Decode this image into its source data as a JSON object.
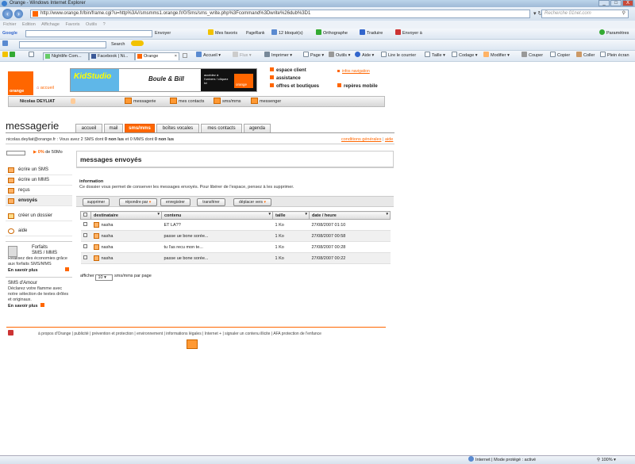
{
  "window": {
    "title": "Orange - Windows Internet Explorer",
    "min": "_",
    "max": "□",
    "close": "X"
  },
  "browser": {
    "url": "http://www.orange.fr/bin/frame.cgi?u=http%3A//smsmms1.orange.fr/0/Sms/sms_write.php%3Fcommand%3Dwrite%26dub%3D1",
    "search_placeholder": "Recherche 01net.com",
    "menu": [
      "Fichier",
      "Edition",
      "Affichage",
      "Favoris",
      "Outils",
      "?"
    ],
    "google_toolbar": {
      "logo": "Google",
      "go": "Envoyer",
      "favorites": "Mes favoris",
      "pagerank": "PageRank",
      "blocked": "12 bloqué(s)",
      "spell": "Orthographe",
      "translate": "Traduire",
      "send": "Envoyer à",
      "settings": "Paramètres"
    },
    "second_toolbar": {
      "search": "Search"
    },
    "tabs": [
      {
        "label": "Nightlife Com..."
      },
      {
        "label": "Facebook | Ni..."
      },
      {
        "label": "Orange"
      }
    ],
    "command_bar": [
      "Accueil",
      "Flux",
      "Imprimer",
      "Page",
      "Outils",
      "Aide",
      "Lire le courrier",
      "Taille",
      "Codage",
      "Modifier",
      "Couper",
      "Copier",
      "Coller",
      "Plein écran"
    ]
  },
  "brand": {
    "logo": "orange",
    "home_link": "accueil"
  },
  "banner": {
    "title": "KidStudio",
    "subtitle": "Boule & Bill",
    "cta": "accédez à l'univers ! cliquez ici",
    "brand": "orange"
  },
  "topnav": {
    "client_space": "espace client",
    "assistance": "assistance",
    "offers": "offres et boutiques",
    "info": "infos navigation",
    "mobile": "repères mobile"
  },
  "userbar": {
    "user": "Nicolas DEYLIAT",
    "items": [
      "messagerie",
      "mes contacts",
      "sms/mms",
      "messenger"
    ]
  },
  "page": {
    "title": "messagerie",
    "tabs": [
      "accueil",
      "mail",
      "sms/mms",
      "boîtes vocales",
      "mes contacts",
      "agenda"
    ],
    "info_line": {
      "prefix": "nicolas.deyliat@orange.fr : Vous avez 2 SMS dont ",
      "u1": "0 non lus",
      "mid": " et 0 MMS dont ",
      "u2": "0 non lus"
    },
    "top_links": {
      "conditions": "conditions générales",
      "sep": "|",
      "help": "aide"
    },
    "quota": {
      "pct": "0%",
      "of": "de 50Mo"
    }
  },
  "sidebar": {
    "items": [
      "écrire un SMS",
      "écrire un MMS",
      "reçus",
      "envoyés",
      "créer un dossier",
      "aide"
    ],
    "promo1": {
      "title_a": "Forfaits",
      "title_b": "SMS / MMS",
      "text": "Réalisez des économies grâce aux forfaits SMS/MMS",
      "more": "En savoir plus"
    },
    "promo2": {
      "title": "SMS d'Amour",
      "text": "Déclarez votre flamme avec notre sélection de textes drôles et originaux.",
      "more": "En savoir plus"
    }
  },
  "main": {
    "title": "messages envoyés",
    "info_heading": "information",
    "info_text": "Ce dossier vous permet de conserver les messages envoyés. Pour libérer de l'espace, pensez à les supprimer.",
    "actions": [
      "supprimer",
      "répondre par",
      "enregistrer",
      "transférer",
      "déplacer vers"
    ],
    "columns": [
      "destinataire",
      "contenu",
      "taille",
      "date / heure"
    ],
    "rows": [
      {
        "to": "nasha",
        "content": "ET LA??",
        "size": "1 Ko",
        "date": "27/08/2007 01:10"
      },
      {
        "to": "nasha",
        "content": "passe ue bone sorée...",
        "size": "1 Ko",
        "date": "27/08/2007 00:58"
      },
      {
        "to": "nasha",
        "content": "tu l'as recu mon te...",
        "size": "1 Ko",
        "date": "27/08/2007 00:28"
      },
      {
        "to": "nasha",
        "content": "passe ue bone sorée...",
        "size": "1 Ko",
        "date": "27/08/2007 00:22"
      }
    ],
    "per_page": {
      "label_a": "afficher",
      "value": "10",
      "label_b": "sms/mms par page"
    }
  },
  "footer": "à propos d'Orange | publicité | prévention et protection | environnement | informations légales | Internet + | signaler un contenu illicite | AFA protection de l'enfance",
  "status": {
    "zone": "Internet | Mode protégé : activé",
    "zoom": "100%"
  },
  "colors": {
    "accent": "#ff6600"
  }
}
